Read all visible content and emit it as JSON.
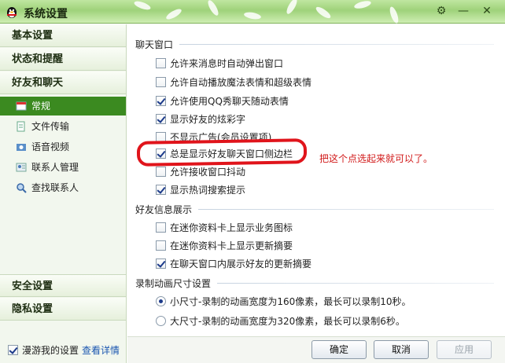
{
  "window": {
    "title": "系统设置",
    "controls": {
      "minimize": "—",
      "close": "✕"
    }
  },
  "sidebar": {
    "categories": {
      "basic": "基本设置",
      "status": "状态和提醒",
      "friends": "好友和聊天",
      "security": "安全设置",
      "privacy": "隐私设置"
    },
    "subitems": [
      {
        "label": "常规",
        "icon": "chat-window-icon",
        "active": true
      },
      {
        "label": "文件传输",
        "icon": "file-transfer-icon",
        "active": false
      },
      {
        "label": "语音视频",
        "icon": "video-call-icon",
        "active": false
      },
      {
        "label": "联系人管理",
        "icon": "contacts-icon",
        "active": false
      },
      {
        "label": "查找联系人",
        "icon": "search-contact-icon",
        "active": false
      }
    ],
    "roaming": {
      "label": "漫游我的设置",
      "checked": true,
      "link": "查看详情"
    }
  },
  "chat_window": {
    "title": "聊天窗口",
    "options": [
      {
        "label": "允许来消息时自动弹出窗口",
        "checked": false
      },
      {
        "label": "允许自动播放魔法表情和超级表情",
        "checked": false
      },
      {
        "label": "允许使用QQ秀聊天随动表情",
        "checked": true
      },
      {
        "label": "显示好友的炫彩字",
        "checked": true
      },
      {
        "label": "不显示广告(会员设置项)",
        "checked": false
      },
      {
        "label": "总是显示好友聊天窗口侧边栏",
        "checked": true
      },
      {
        "label": "允许接收窗口抖动",
        "checked": false
      },
      {
        "label": "显示热词搜索提示",
        "checked": true
      }
    ]
  },
  "friend_info": {
    "title": "好友信息展示",
    "options": [
      {
        "label": "在迷你资料卡上显示业务图标",
        "checked": false
      },
      {
        "label": "在迷你资料卡上显示更新摘要",
        "checked": false
      },
      {
        "label": "在聊天窗口内展示好友的更新摘要",
        "checked": true
      }
    ]
  },
  "recording": {
    "title": "录制动画尺寸设置",
    "options": [
      {
        "label": "小尺寸-录制的动画宽度为160像素，最长可以录制10秒。",
        "selected": true
      },
      {
        "label": "大尺寸-录制的动画宽度为320像素，最长可以录制6秒。",
        "selected": false
      }
    ]
  },
  "annotation": {
    "text": "把这个点选起来就可以了。",
    "color": "#e0141b"
  },
  "buttons": {
    "ok": "确定",
    "cancel": "取消",
    "apply": "应用"
  },
  "colors": {
    "accent_green": "#3b8a20",
    "link_blue": "#1a56b0"
  }
}
